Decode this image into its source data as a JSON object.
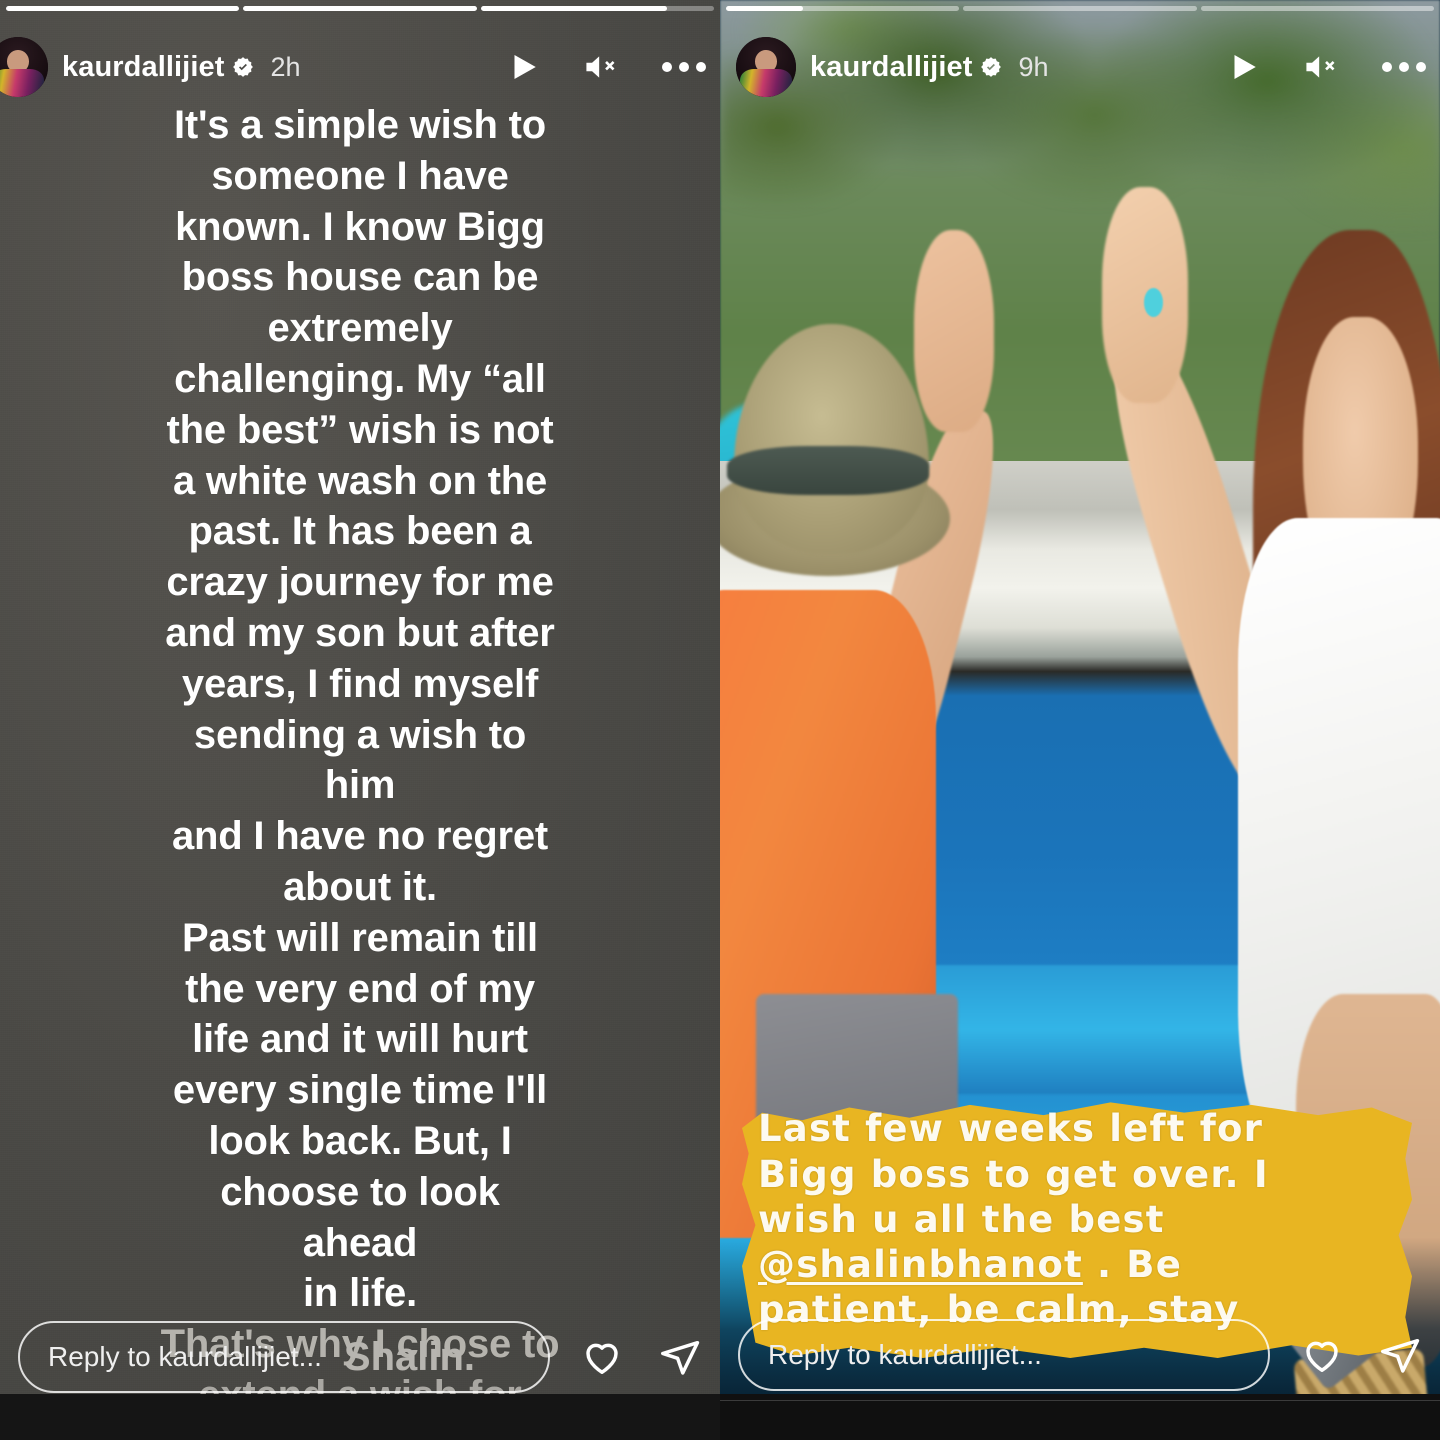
{
  "app": "instagram-stories-viewer",
  "stories": [
    {
      "id": "story-left",
      "username": "kaurdallijiet",
      "verified": true,
      "timestamp": "2h",
      "progress": {
        "segments": 3,
        "fills": [
          100,
          100,
          80
        ]
      },
      "header_icons": [
        "play-icon",
        "mute-icon",
        "more-options-icon"
      ],
      "text_overlay": "It's a simple wish to\nsomeone I have\nknown. I know Bigg\nboss house can be\nextremely\nchallenging. My “all\nthe best” wish is not\na white wash on the\npast. It has been a\ncrazy journey for me\nand my son but after\nyears, I find myself\nsending a wish to him\nand I have no regret\nabout it.\nPast will remain till\nthe very end of my\nlife and it will hurt\nevery single time I'll\nlook back. But, I\nchoose to look ahead\nin life.",
      "text_overlay_tail": "That's why I chose to",
      "text_overlay_tail2": "extend a wish for",
      "overlap_word": "Shalin.",
      "reply_placeholder": "Reply to kaurdallijiet...",
      "actions": [
        "like-icon",
        "share-icon"
      ]
    },
    {
      "id": "story-right",
      "username": "kaurdallijiet",
      "verified": true,
      "timestamp": "9h",
      "progress": {
        "segments": 3,
        "fills": [
          33,
          0,
          0
        ]
      },
      "header_icons": [
        "play-icon",
        "mute-icon",
        "more-options-icon"
      ],
      "caption_line1": "Last few weeks left for",
      "caption_line2": "Bigg boss to get over. I",
      "caption_line3": "wish u all the best",
      "caption_mention": "@shalinbhanot",
      "caption_line4_rest": " . Be",
      "caption_line5": "patient, be calm, stay",
      "highlight_color": "#e8b522",
      "reply_placeholder": "Reply to kaurdallijiet...",
      "actions": [
        "like-icon",
        "share-icon"
      ]
    }
  ],
  "colors": {
    "left_background": "#4b4a46",
    "text_white": "#ffffff",
    "text_faded": "#b5b3ad",
    "highlight_yellow": "#e8b522",
    "verified_blue": "#ffffff"
  }
}
